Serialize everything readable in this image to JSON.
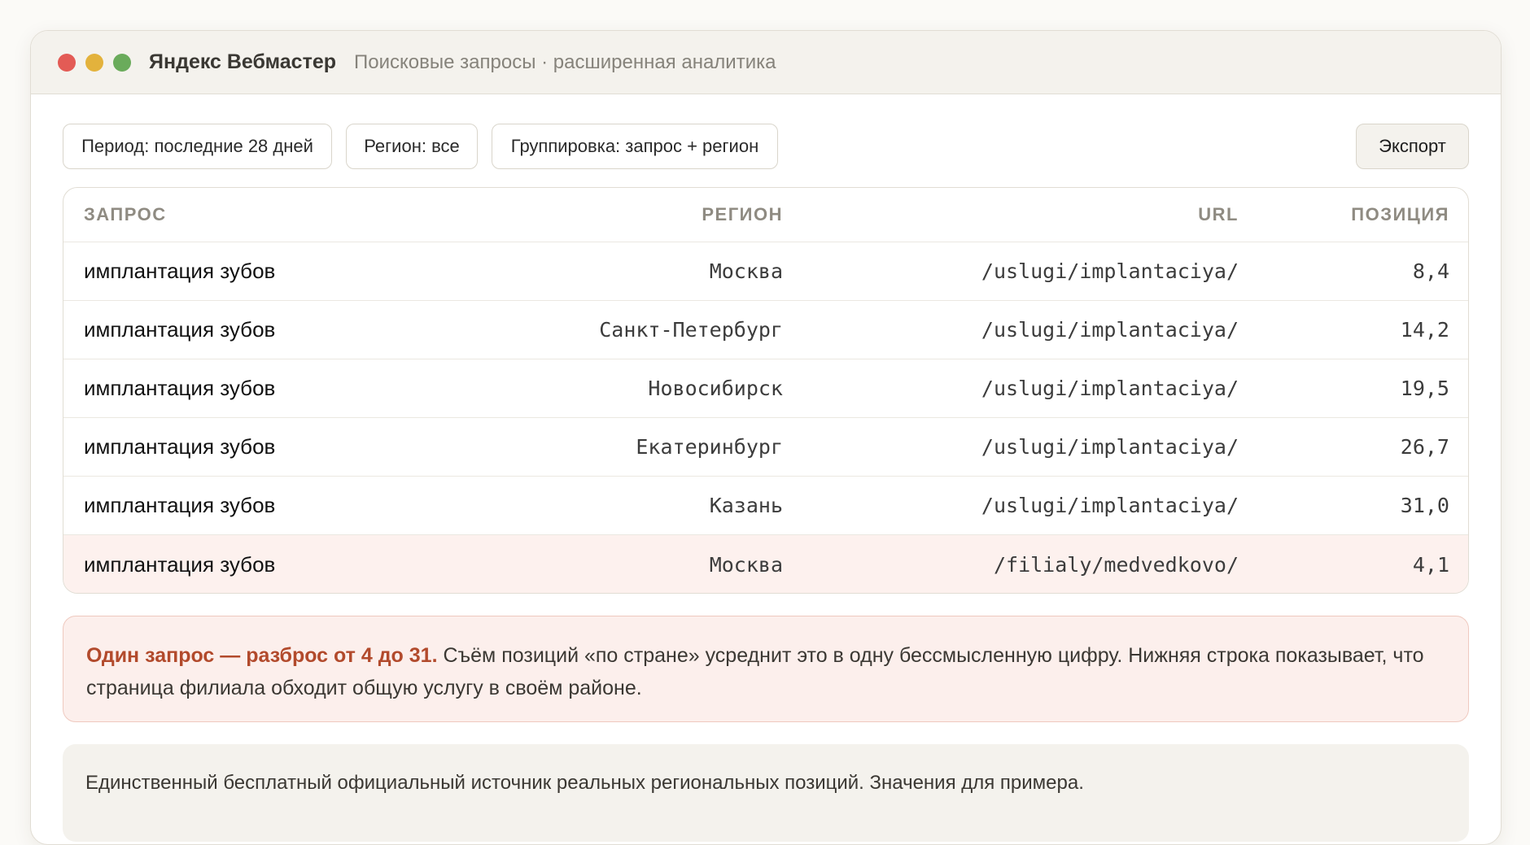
{
  "window": {
    "title": "Яндекс Вебмастер",
    "subtitle": "Поисковые запросы · расширенная аналитика"
  },
  "filters": {
    "period": "Период: последние 28 дней",
    "region": "Регион: все",
    "grouping": "Группировка: запрос + регион",
    "export_label": "Экспорт"
  },
  "table": {
    "headers": {
      "query": "ЗАПРОС",
      "region": "РЕГИОН",
      "url": "URL",
      "position": "ПОЗИЦИЯ"
    },
    "rows": [
      {
        "query": "имплантация зубов",
        "region": "Москва",
        "url": "/uslugi/implantaciya/",
        "position": "8,4"
      },
      {
        "query": "имплантация зубов",
        "region": "Санкт-Петербург",
        "url": "/uslugi/implantaciya/",
        "position": "14,2"
      },
      {
        "query": "имплантация зубов",
        "region": "Новосибирск",
        "url": "/uslugi/implantaciya/",
        "position": "19,5"
      },
      {
        "query": "имплантация зубов",
        "region": "Екатеринбург",
        "url": "/uslugi/implantaciya/",
        "position": "26,7"
      },
      {
        "query": "имплантация зубов",
        "region": "Казань",
        "url": "/uslugi/implantaciya/",
        "position": "31,0"
      },
      {
        "query": "имплантация зубов",
        "region": "Москва",
        "url": "/filialy/medvedkovo/",
        "position": "4,1"
      }
    ]
  },
  "warning": {
    "lead": "Один запрос — разброс от 4 до 31.",
    "text": " Съём позиций «по стране» усреднит это в одну бессмысленную цифру. Нижняя строка показывает, что страница филиала обходит общую услугу в своём районе."
  },
  "note": {
    "text": "Единственный бесплатный официальный источник реальных региональных позиций. Значения для примера."
  },
  "colors": {
    "accent": "#b24a2c",
    "highlight_row": "#fdf1ee",
    "dot_red": "#e35b55",
    "dot_yellow": "#e3b23c",
    "dot_green": "#6aab5b"
  }
}
